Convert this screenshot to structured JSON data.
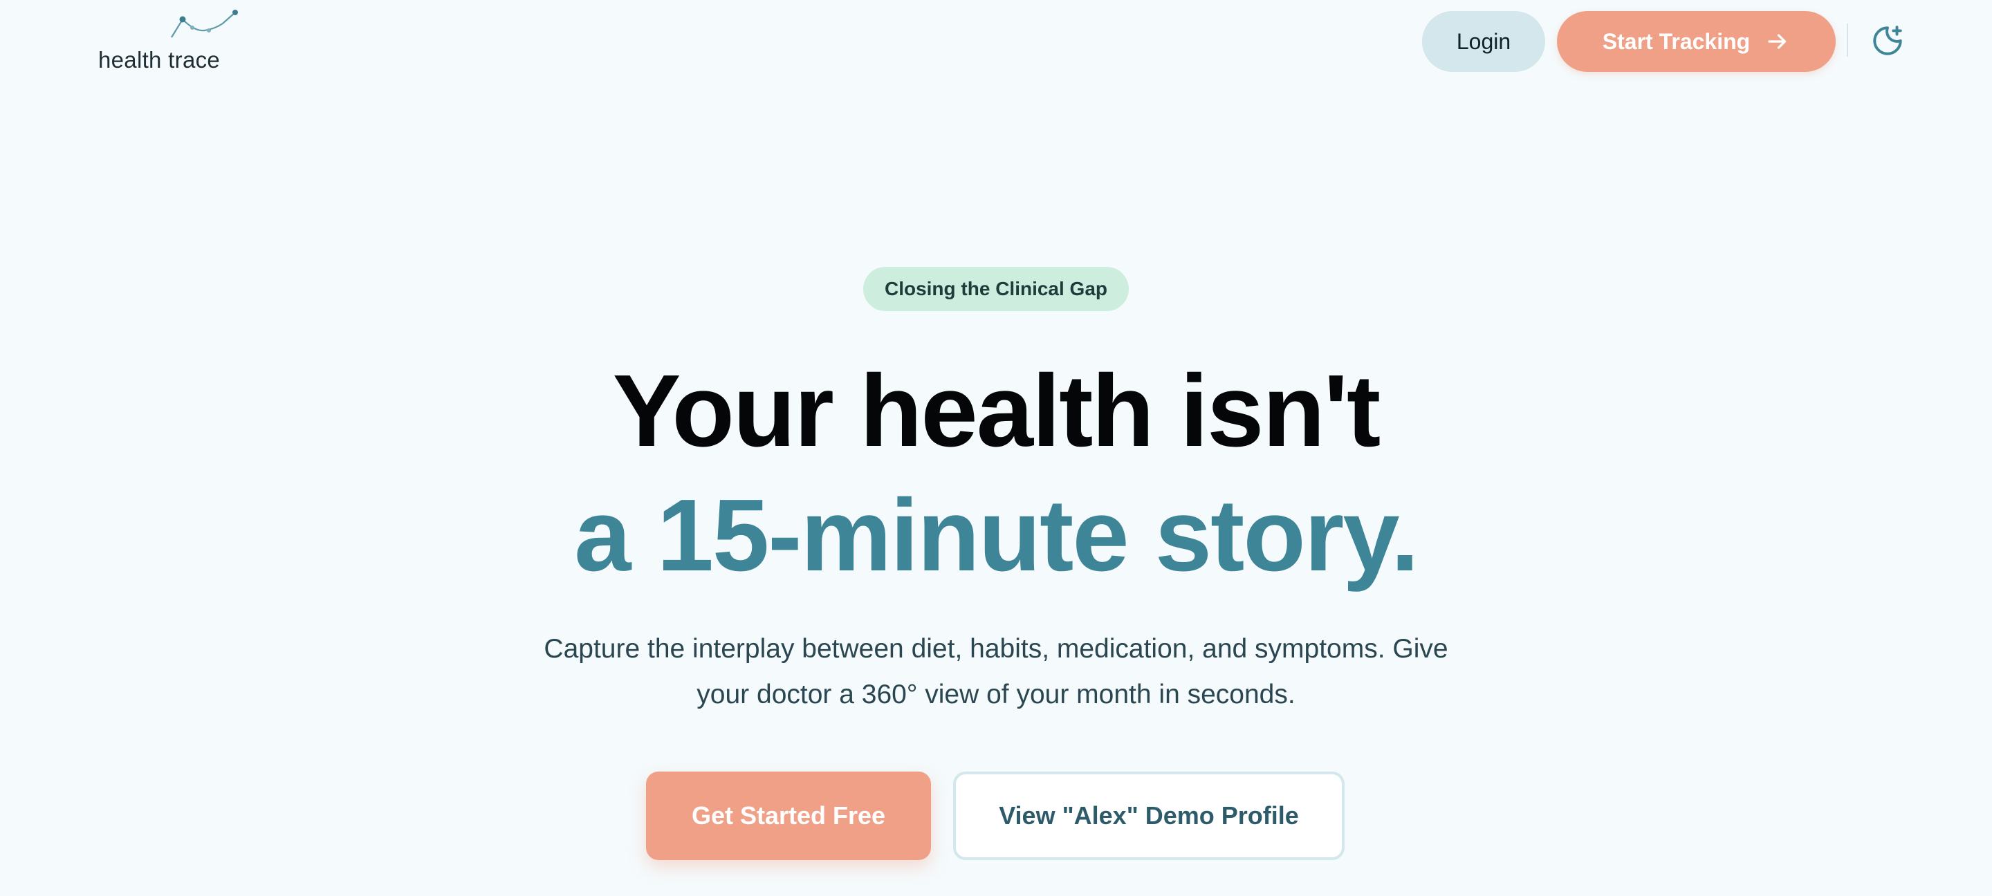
{
  "header": {
    "logo_text": "health trace",
    "login_label": "Login",
    "start_label": "Start Tracking",
    "arrow_icon": "arrow-right-icon",
    "theme_icon": "moon-star-icon"
  },
  "hero": {
    "badge": "Closing the Clinical Gap",
    "headline_line1": "Your health isn't",
    "headline_line2": "a 15-minute story.",
    "subtext": "Capture the interplay between diet, habits, medication, and symptoms. Give your doctor a 360° view of your month in seconds.",
    "cta_primary": "Get Started Free",
    "cta_secondary": "View \"Alex\" Demo Profile"
  },
  "colors": {
    "background": "#f5fafc",
    "accent_coral": "#f0a087",
    "accent_teal": "#3e8597",
    "badge_green": "#cdeede",
    "login_bg": "#d3e7ec"
  }
}
